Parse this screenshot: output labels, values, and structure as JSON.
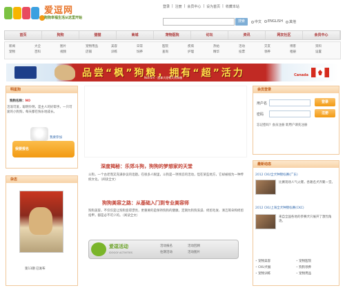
{
  "header": {
    "logo_text": "爱逗网",
    "tagline": "狗狗幸福生活从这里开始",
    "top_links": [
      "登录",
      "注册",
      "会员中心",
      "设为首页",
      "收藏本站"
    ],
    "search_placeholder": "",
    "search_button": "搜索",
    "search_options": [
      "中文",
      "ENGLISH",
      "其他"
    ]
  },
  "nav": {
    "items": [
      "首页",
      "狗狗",
      "猫猫",
      "商城",
      "宠物医院",
      "论坛",
      "资讯",
      "网友社区",
      "会员中心"
    ]
  },
  "subnav": {
    "cols": [
      [
        "新闻",
        "宠物"
      ],
      [
        "大全",
        "百科"
      ],
      [
        "图片",
        "视频"
      ],
      [
        "宠物用品",
        "店铺"
      ],
      [
        "美容",
        "训练"
      ],
      [
        "日常",
        "饲养"
      ],
      [
        "医院",
        "查询"
      ],
      [
        "疾病",
        "护理"
      ],
      [
        "热帖",
        "精华"
      ],
      [
        "活动",
        "投票"
      ],
      [
        "交友",
        "领养"
      ],
      [
        "博客",
        "相册"
      ],
      [
        "资料",
        "设置"
      ]
    ]
  },
  "banner": {
    "headline": "品尝“枫”狗粮，拥有“超”活力",
    "subline": "Nutram - 加拿大纽顿天然狗粮",
    "brand": "Canada"
  },
  "left": {
    "box1_title": "明星狗",
    "star_name": "狗狗名称：",
    "star_value": "NO",
    "star_desc": "活泼可爱，聪明伶俐，是主人的好帮手。一只可爱的小狗狗，每天都在快乐地成长。",
    "star_link": "我要参加",
    "join_button": "我要报名",
    "box2_title": "杂志",
    "mag_caption": "第13期 已发布"
  },
  "center": {
    "article1_title": "深度揭秘：乐郊斗狗，狗狗的梦想家的天堂",
    "article1_body": "斗狗，一个古老而又充满争议的话题。在很多人眼里，斗狗是一项残忍的活动，但在某些地方，它却被视为一种传统文化。（阅读全文）",
    "article2_title": "狗狗美容之路：从基础入门到专业美容师",
    "article2_body": "狗狗美容，不仅仅是让狗狗变得漂亮，更重要的是保持狗狗的健康。定期为狗狗洗澡、修剪毛发、清洁耳朵和修剪指甲，都是必不可少的。（阅读全文）",
    "activity_title": "爱逗活动",
    "activity_en": "IDOGGY ACTIVITIES",
    "activity_links": [
      "活动报名",
      "活动回顾",
      "往期活动",
      "活动图片"
    ]
  },
  "right": {
    "login_title": "会员登录",
    "username_label": "用户名",
    "password_label": "密码",
    "login_button": "登录",
    "register_button": "注册",
    "login_note": "忘记密码？会员注册 新用户请先注册",
    "news_title": "最新动态",
    "news": [
      "2012 CKU全犬种锦标赛(广东)",
      "2012 CKU上海全犬种锦标赛(CKC)"
    ],
    "news_desc": [
      "比赛现场人气火爆，各路名犬齐聚一堂。",
      "来自全国各地的参赛犬只展开了激烈角逐。"
    ],
    "quick_links": [
      "宠物美容",
      "宠物医院",
      "CKU犬展",
      "狗狗领养",
      "宠物训练",
      "宠物用品"
    ]
  }
}
